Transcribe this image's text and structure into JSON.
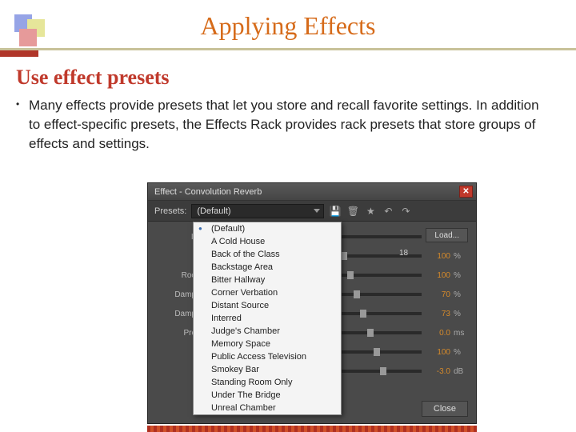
{
  "slide": {
    "title": "Applying Effects",
    "subtitle": "Use effect presets",
    "paragraph": "Many effects provide presets that let you store and recall favorite settings. In addition to effect-specific presets, the Effects Rack provides rack presets that store groups of effects and settings."
  },
  "panel": {
    "title": "Effect - Convolution Reverb",
    "presets_label": "Presets:",
    "selected_preset": "(Default)",
    "load_button": "Load...",
    "close_button": "Close",
    "params": [
      {
        "label": "Ir",
        "value": "",
        "unit": ""
      },
      {
        "label": "",
        "value": "100",
        "unit": "%"
      },
      {
        "label": "Roo",
        "value": "100",
        "unit": "%"
      },
      {
        "label": "Damp",
        "value": "70",
        "unit": "%"
      },
      {
        "label": "Damp",
        "value": "73",
        "unit": "%"
      },
      {
        "label": "Pre",
        "value": "0.0",
        "unit": "ms"
      },
      {
        "label": "",
        "value": "100",
        "unit": "%"
      },
      {
        "label": "",
        "value": "-3.0",
        "unit": "dB"
      }
    ],
    "gain_tick": "18"
  },
  "dropdown_options": [
    "(Default)",
    "A Cold House",
    "Back of the Class",
    "Backstage Area",
    "Bitter Hallway",
    "Corner Verbation",
    "Distant Source",
    "Interred",
    "Judge's Chamber",
    "Memory Space",
    "Public Access Television",
    "Smokey Bar",
    "Standing Room Only",
    "Under The Bridge",
    "Unreal Chamber"
  ]
}
